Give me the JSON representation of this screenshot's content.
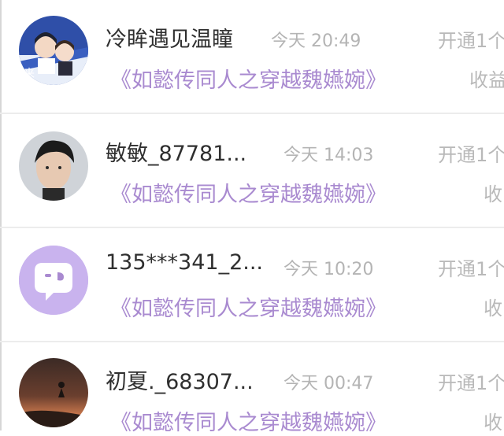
{
  "notifications": [
    {
      "user": "冷眸遇见温瞳",
      "time": "今天 20:49",
      "book": "《如懿传同人之穿越魏嬿婉》",
      "right_line1": "开通1个",
      "right_line2": "收益",
      "avatar": "anime-avatar"
    },
    {
      "user": "敏敏_87781...",
      "time": "今天 14:03",
      "book": "《如懿传同人之穿越魏嬿婉》",
      "right_line1": "开通1个",
      "right_line2": "收",
      "avatar": "photo-avatar"
    },
    {
      "user": "135***341_2...",
      "time": "今天 10:20",
      "book": "《如懿传同人之穿越魏嬿婉》",
      "right_line1": "开通1个",
      "right_line2": "收",
      "avatar": "default-chat-avatar"
    },
    {
      "user": "初夏._68307...",
      "time": "今天 00:47",
      "book": "《如懿传同人之穿越魏嬿婉》",
      "right_line1": "开通1个",
      "right_line2": "收",
      "avatar": "sunset-avatar"
    }
  ],
  "colors": {
    "accent_purple": "#a98ad0",
    "default_avatar_bg": "#c9b3ee",
    "name_text": "#2f2f2f",
    "meta_text": "#b4b4b4"
  }
}
